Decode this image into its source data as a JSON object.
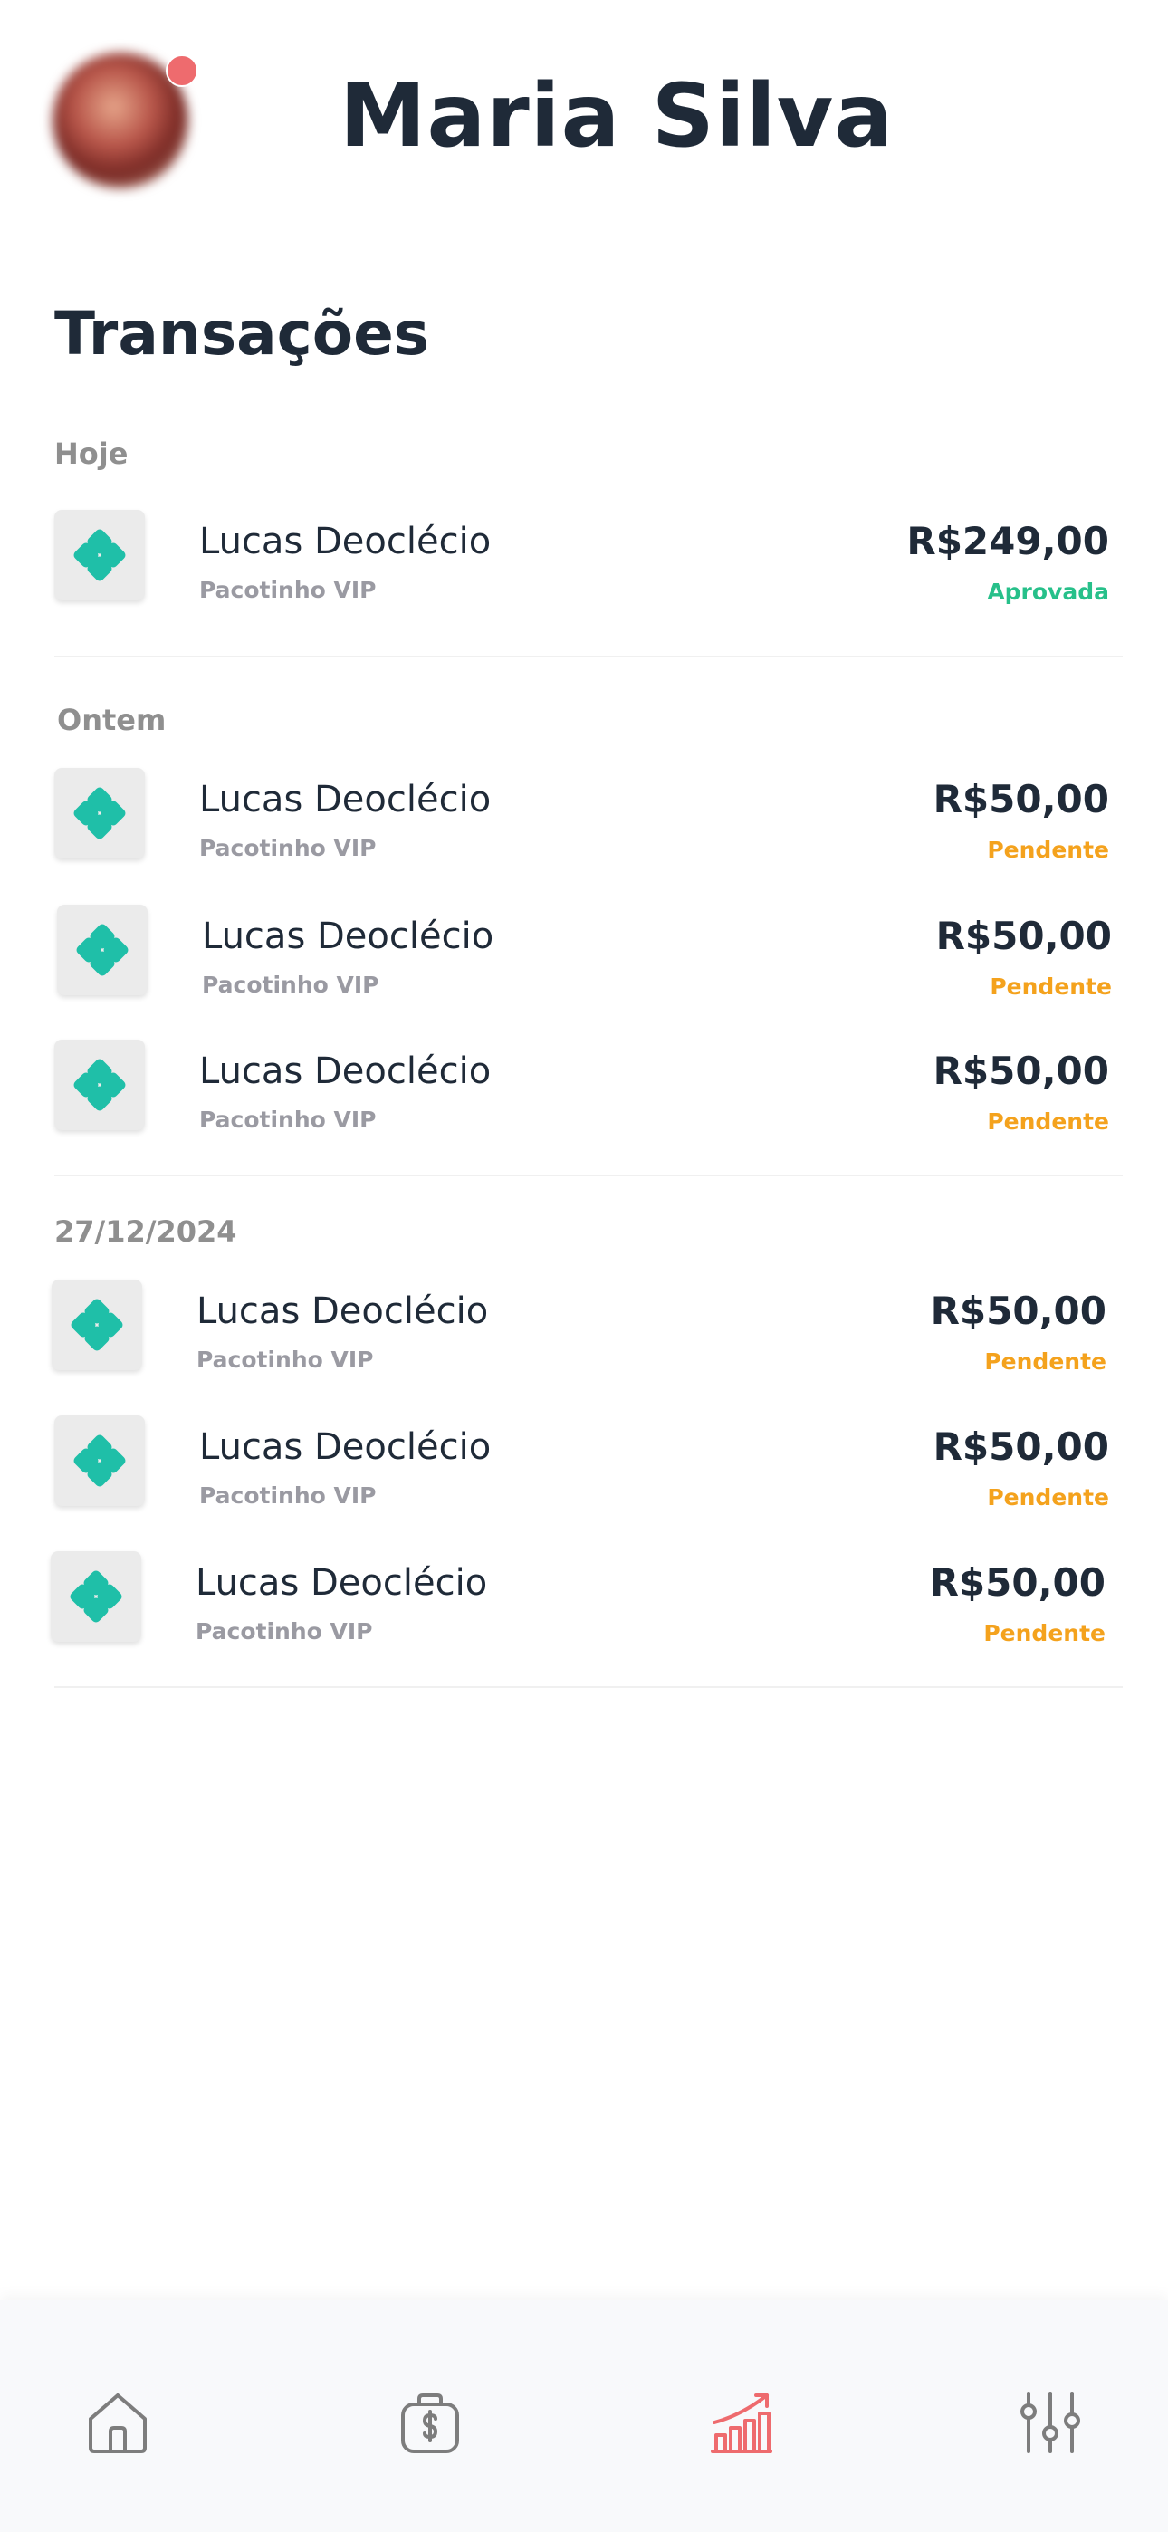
{
  "header": {
    "user_name": "Maria Silva"
  },
  "page": {
    "title": "Transações"
  },
  "sections": [
    {
      "label": "Hoje",
      "items": [
        {
          "name": "Lucas Deoclécio",
          "product": "Pacotinho VIP",
          "amount": "R$249,00",
          "status": "Aprovada"
        }
      ]
    },
    {
      "label": "Ontem",
      "items": [
        {
          "name": "Lucas Deoclécio",
          "product": "Pacotinho VIP",
          "amount": "R$50,00",
          "status": "Pendente"
        },
        {
          "name": "Lucas Deoclécio",
          "product": "Pacotinho VIP",
          "amount": "R$50,00",
          "status": "Pendente"
        },
        {
          "name": "Lucas Deoclécio",
          "product": "Pacotinho VIP",
          "amount": "R$50,00",
          "status": "Pendente"
        }
      ]
    },
    {
      "label": "27/12/2024",
      "items": [
        {
          "name": "Lucas Deoclécio",
          "product": "Pacotinho VIP",
          "amount": "R$50,00",
          "status": "Pendente"
        },
        {
          "name": "Lucas Deoclécio",
          "product": "Pacotinho VIP",
          "amount": "R$50,00",
          "status": "Pendente"
        },
        {
          "name": "Lucas Deoclécio",
          "product": "Pacotinho VIP",
          "amount": "R$50,00",
          "status": "Pendente"
        }
      ]
    }
  ],
  "nav": {
    "items": [
      {
        "icon": "home-icon",
        "active": false
      },
      {
        "icon": "money-bag-icon",
        "active": false
      },
      {
        "icon": "chart-icon",
        "active": true
      },
      {
        "icon": "settings-sliders-icon",
        "active": false
      }
    ]
  },
  "colors": {
    "primary_text": "#1f2a38",
    "approved": "#27c08a",
    "pending": "#f4a21d",
    "pix_icon": "#1fbfa8",
    "nav_active": "#ee6b6e",
    "nav_inactive": "#7d7d7d",
    "notification_dot": "#ee6b6e"
  }
}
